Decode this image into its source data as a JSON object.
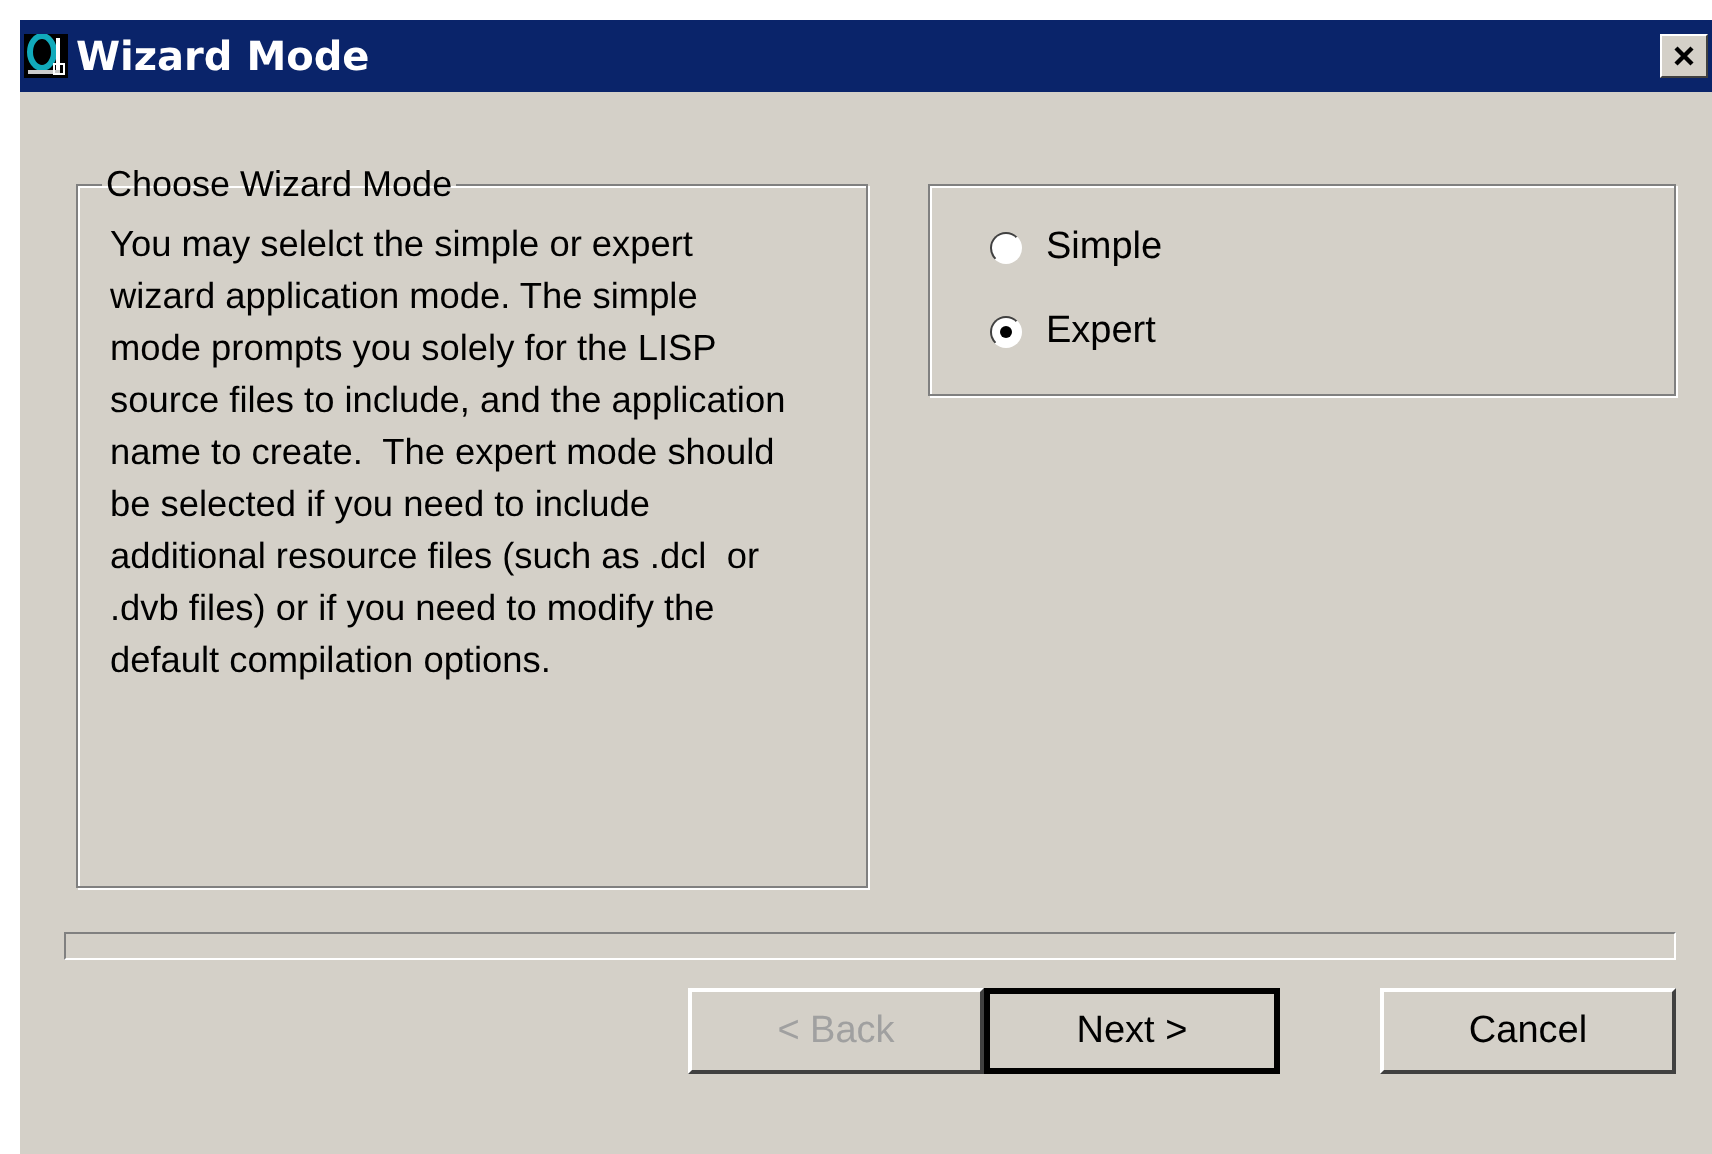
{
  "window": {
    "title": "Wizard Mode"
  },
  "group": {
    "title": "Choose Wizard Mode",
    "description": "You may selelct the simple or expert wizard application mode. The simple mode prompts you solely for the LISP source files to include, and the application name to create.  The expert mode should be selected if you need to include additional resource files (such as .dcl  or .dvb files) or if you need to modify the default compilation options."
  },
  "modes": [
    {
      "label": "Simple",
      "selected": false
    },
    {
      "label": "Expert",
      "selected": true
    }
  ],
  "buttons": [
    {
      "label": "< Back",
      "disabled": true,
      "default": false
    },
    {
      "label": "Next >",
      "disabled": false,
      "default": true
    },
    {
      "label": "Cancel",
      "disabled": false,
      "default": false
    }
  ]
}
